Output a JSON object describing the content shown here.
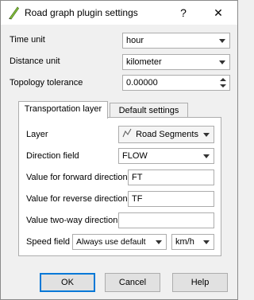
{
  "window": {
    "title": "Road graph plugin settings",
    "help_glyph": "?",
    "close_glyph": "✕"
  },
  "general": {
    "time_unit_label": "Time unit",
    "time_unit_value": "hour",
    "distance_unit_label": "Distance unit",
    "distance_unit_value": "kilometer",
    "topology_tolerance_label": "Topology tolerance",
    "topology_tolerance_value": "0.00000"
  },
  "tabs": [
    {
      "label": "Transportation layer",
      "active": true
    },
    {
      "label": "Default settings",
      "active": false
    }
  ],
  "transportation": {
    "layer_label": "Layer",
    "layer_value": "Road Segments",
    "direction_field_label": "Direction field",
    "direction_field_value": "FLOW",
    "forward_label": "Value for forward direction",
    "forward_value": "FT",
    "reverse_label": "Value for reverse direction",
    "reverse_value": "TF",
    "two_way_label": "Value two-way direction",
    "two_way_value": "",
    "speed_field_label": "Speed field",
    "speed_field_value": "Always use default",
    "speed_unit_value": "km/h"
  },
  "buttons": {
    "ok": "OK",
    "cancel": "Cancel",
    "help": "Help"
  },
  "colors": {
    "accent": "#0078d7",
    "icon_green": "#5c9a2f"
  },
  "icons": {
    "title": "qgis-pen-icon",
    "layer": "line-layer-icon"
  }
}
